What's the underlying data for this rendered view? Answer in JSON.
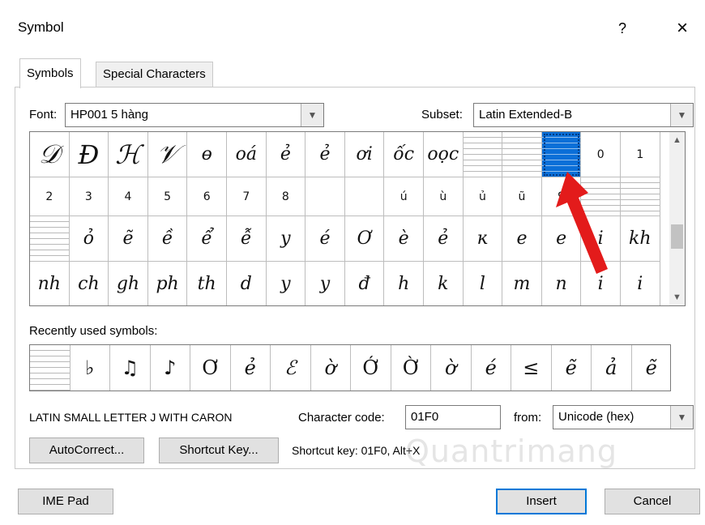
{
  "dialog": {
    "title": "Symbol",
    "help_label": "?",
    "close_label": "×"
  },
  "tabs": [
    {
      "label": "Symbols",
      "active": true
    },
    {
      "label": "Special Characters",
      "active": false
    }
  ],
  "font_label": "Font:",
  "font_value": "HP001 5 hàng",
  "subset_label": "Subset:",
  "subset_value": "Latin Extended-B",
  "grid_rows": [
    [
      "𝒟",
      "Đ",
      "ℋ",
      "𝒱",
      "ɵ",
      "oá",
      "ẻ",
      "ẻ",
      "ơi",
      "ốc",
      "oọc",
      "",
      "",
      "",
      "0",
      "1"
    ],
    [
      "2",
      "3",
      "4",
      "5",
      "6",
      "7",
      "8",
      "",
      "",
      "ú",
      "ù",
      "ủ",
      "ũ",
      "9",
      "",
      ""
    ],
    [
      "",
      "ỏ",
      "ẽ",
      "ề",
      "ể",
      "ễ",
      "y",
      "é",
      "Ơ",
      "è",
      "ẻ",
      "ĸ",
      "e",
      "e",
      "i",
      "kh"
    ],
    [
      "nh",
      "ch",
      "gh",
      "ph",
      "th",
      "d",
      "y",
      "y",
      "đ",
      "h",
      "k",
      "l",
      "m",
      "n",
      "i",
      "i"
    ]
  ],
  "recently_label": "Recently used symbols:",
  "recent_symbols": [
    "",
    "♭",
    "♫",
    "♪",
    "Ơ",
    "ẻ",
    "ℰ",
    "ờ",
    "Ớ",
    "Ờ",
    "ờ",
    "é",
    "≤",
    "ẽ",
    "ả",
    "ẽ"
  ],
  "char_name": "LATIN SMALL LETTER J WITH CARON",
  "char_code_label": "Character code:",
  "char_code_value": "01F0",
  "from_label": "from:",
  "from_value": "Unicode (hex)",
  "autocorrect_label": "AutoCorrect...",
  "shortcut_key_btn_label": "Shortcut Key...",
  "shortcut_key_text": "Shortcut key: 01F0, Alt+X",
  "ime_pad_label": "IME Pad",
  "insert_label": "Insert",
  "cancel_label": "Cancel",
  "watermark": "Quantrimang",
  "colors": {
    "selection": "#0b6fd8",
    "arrow": "#e31b1b",
    "default_border": "#0078d7"
  },
  "scroll_icons": {
    "up": "chevron-up",
    "down": "chevron-down"
  }
}
